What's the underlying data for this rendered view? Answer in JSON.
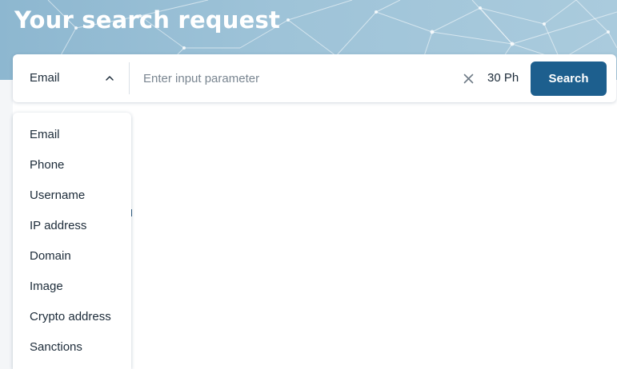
{
  "header": {
    "title": "Your search request"
  },
  "search": {
    "selected_type": "Email",
    "placeholder": "Enter input parameter",
    "value": "",
    "credits": "30 Ph",
    "button_label": "Search"
  },
  "dropdown": {
    "options": [
      {
        "label": "Email"
      },
      {
        "label": "Phone"
      },
      {
        "label": "Username"
      },
      {
        "label": "IP address"
      },
      {
        "label": "Domain"
      },
      {
        "label": "Image"
      },
      {
        "label": "Crypto address"
      },
      {
        "label": "Sanctions"
      }
    ]
  },
  "icons": {
    "select_toggle": "chevron-up-icon",
    "clear": "close-icon"
  },
  "colors": {
    "banner": "#9ec3d8",
    "primary_button": "#1d5f8e",
    "text": "#1c2b39",
    "placeholder": "#7a8691"
  }
}
